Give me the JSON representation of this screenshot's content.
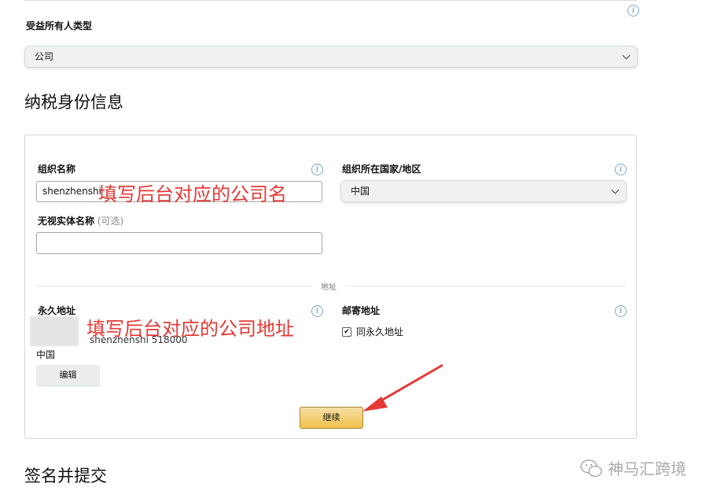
{
  "beneficial_owner": {
    "label": "受益所有人类型",
    "select_value": "公司"
  },
  "tax_identity": {
    "title": "纳税身份信息",
    "org_name_label": "组织名称",
    "org_name_value": "shenzhenshi",
    "org_country_label": "组织所在国家/地区",
    "org_country_value": "中国",
    "disregarded_entity_label": "无视实体名称",
    "disregarded_entity_optional": "(可选)",
    "disregarded_entity_value": "",
    "address_divider": "地址",
    "permanent_address_label": "永久地址",
    "permanent_address_line": "shenzhenshi 518000",
    "permanent_address_country": "中国",
    "edit_button": "编辑",
    "mailing_address_label": "邮寄地址",
    "same_as_permanent_label": "同永久地址",
    "same_as_permanent_checked": true,
    "continue_button": "继续"
  },
  "sign_submit": {
    "title": "签名并提交"
  },
  "annotations": {
    "company_name_hint": "填写后台对应的公司名",
    "company_address_hint": "填写后台对应的公司地址"
  },
  "watermark": {
    "text": "神马汇跨境"
  },
  "icons": {
    "info": "info-icon",
    "dropdown": "chevron-down-icon",
    "checkbox": "checkbox-icon",
    "arrow": "red-arrow-icon",
    "wechat": "wechat-icon"
  },
  "colors": {
    "annotation": "#e53935",
    "continue_button": "#f0c14b",
    "info_icon": "#4b86b4"
  }
}
